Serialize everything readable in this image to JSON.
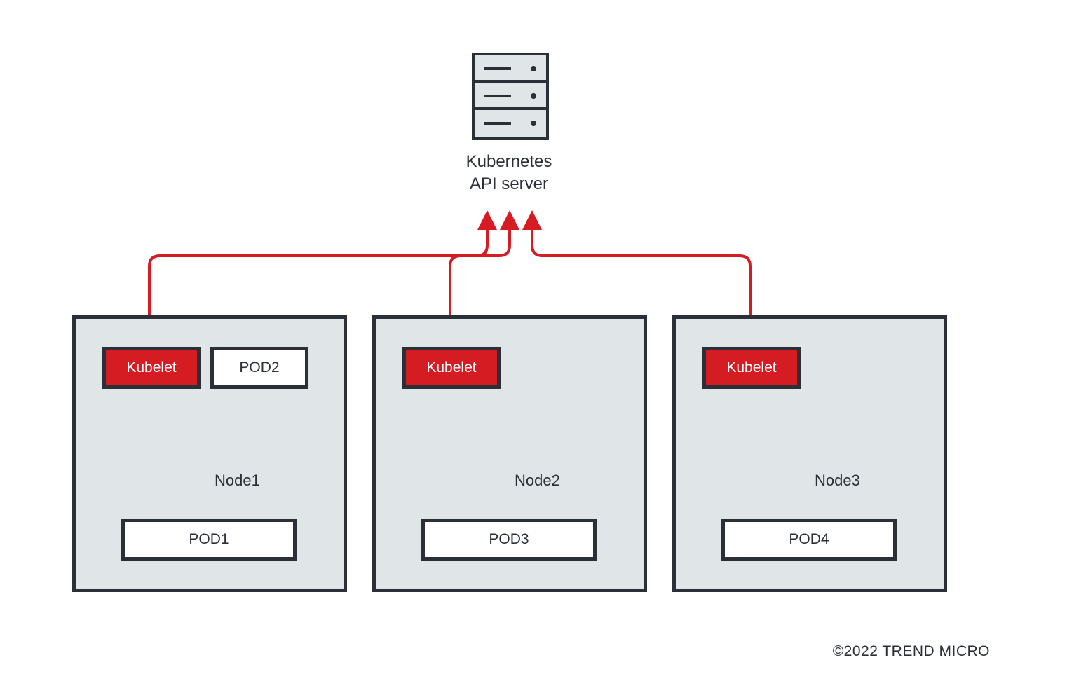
{
  "api_server": {
    "label_line1": "Kubernetes",
    "label_line2": "API server"
  },
  "nodes": [
    {
      "name": "Node1",
      "kubelet": "Kubelet",
      "pods": [
        "POD2",
        "POD1"
      ]
    },
    {
      "name": "Node2",
      "kubelet": "Kubelet",
      "pods": [
        "POD3"
      ]
    },
    {
      "name": "Node3",
      "kubelet": "Kubelet",
      "pods": [
        "POD4"
      ]
    }
  ],
  "copyright": "©2022 TREND MICRO",
  "colors": {
    "dark": "#2b3038",
    "red": "#d51c23",
    "panel": "#e0e5e8"
  }
}
